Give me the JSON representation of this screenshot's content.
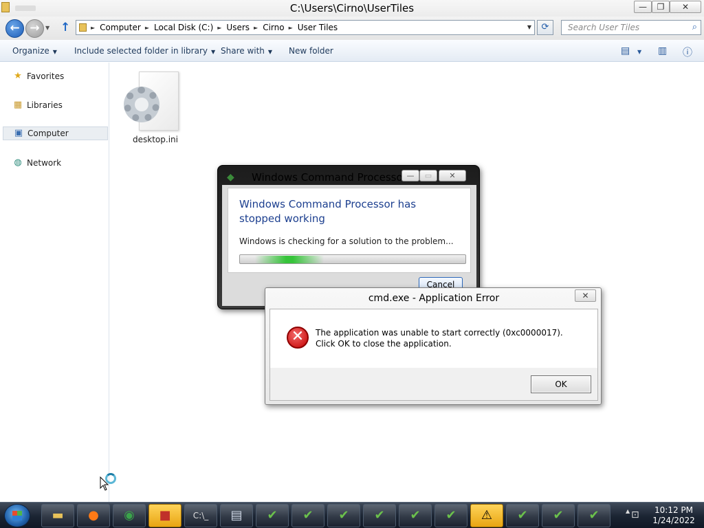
{
  "explorer": {
    "title": "C:\\Users\\Cirno\\UserTiles",
    "address": [
      "Computer",
      "Local Disk (C:)",
      "Users",
      "Cirno",
      "User Tiles"
    ],
    "search_placeholder": "Search User Tiles",
    "toolbar": {
      "organize": "Organize",
      "include": "Include selected folder in library",
      "share": "Share with",
      "new_folder": "New folder"
    },
    "nav": {
      "favorites": "Favorites",
      "libraries": "Libraries",
      "computer": "Computer",
      "network": "Network"
    },
    "file": {
      "name": "desktop.ini"
    }
  },
  "wcp_dialog": {
    "title": "Windows Command Processor",
    "heading": "Windows Command Processor has stopped working",
    "message": "Windows is checking for a solution to the problem...",
    "cancel": "Cancel"
  },
  "error_dialog": {
    "title": "cmd.exe - Application Error",
    "message": "The application was unable to start correctly (0xc0000017). Click OK to close the application.",
    "ok": "OK"
  },
  "taskbar": {
    "time": "10:12 PM",
    "date": "1/24/2022",
    "items": [
      "explorer",
      "firefox",
      "chrome",
      "app",
      "cmd",
      "window",
      "installer",
      "installer",
      "installer",
      "installer",
      "installer",
      "installer",
      "warning",
      "installer",
      "installer",
      "installer"
    ]
  },
  "colors": {
    "heading_blue": "#1c3f8f",
    "progress_green": "#36c43a",
    "error_red": "#c40000"
  }
}
